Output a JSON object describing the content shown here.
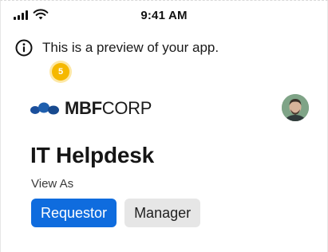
{
  "status_bar": {
    "time": "9:41 AM",
    "signal_icon": "cellular-signal-icon",
    "wifi_icon": "wifi-icon"
  },
  "preview_banner": {
    "icon": "info-icon",
    "text": "This is a preview of your app."
  },
  "step_badge": {
    "number": "5",
    "color": "#f5b800"
  },
  "header": {
    "logo_bold": "MBF",
    "logo_light": "CORP",
    "logo_icon": "mbf-logo-mark-icon",
    "avatar": "user-avatar"
  },
  "main": {
    "title": "IT Helpdesk",
    "view_as_label": "View As",
    "roles": [
      {
        "label": "Requestor",
        "selected": true
      },
      {
        "label": "Manager",
        "selected": false
      }
    ]
  },
  "colors": {
    "accent": "#0f6cde",
    "inactive_button": "#e6e6e6",
    "logo_blue": "#1f5fae"
  }
}
